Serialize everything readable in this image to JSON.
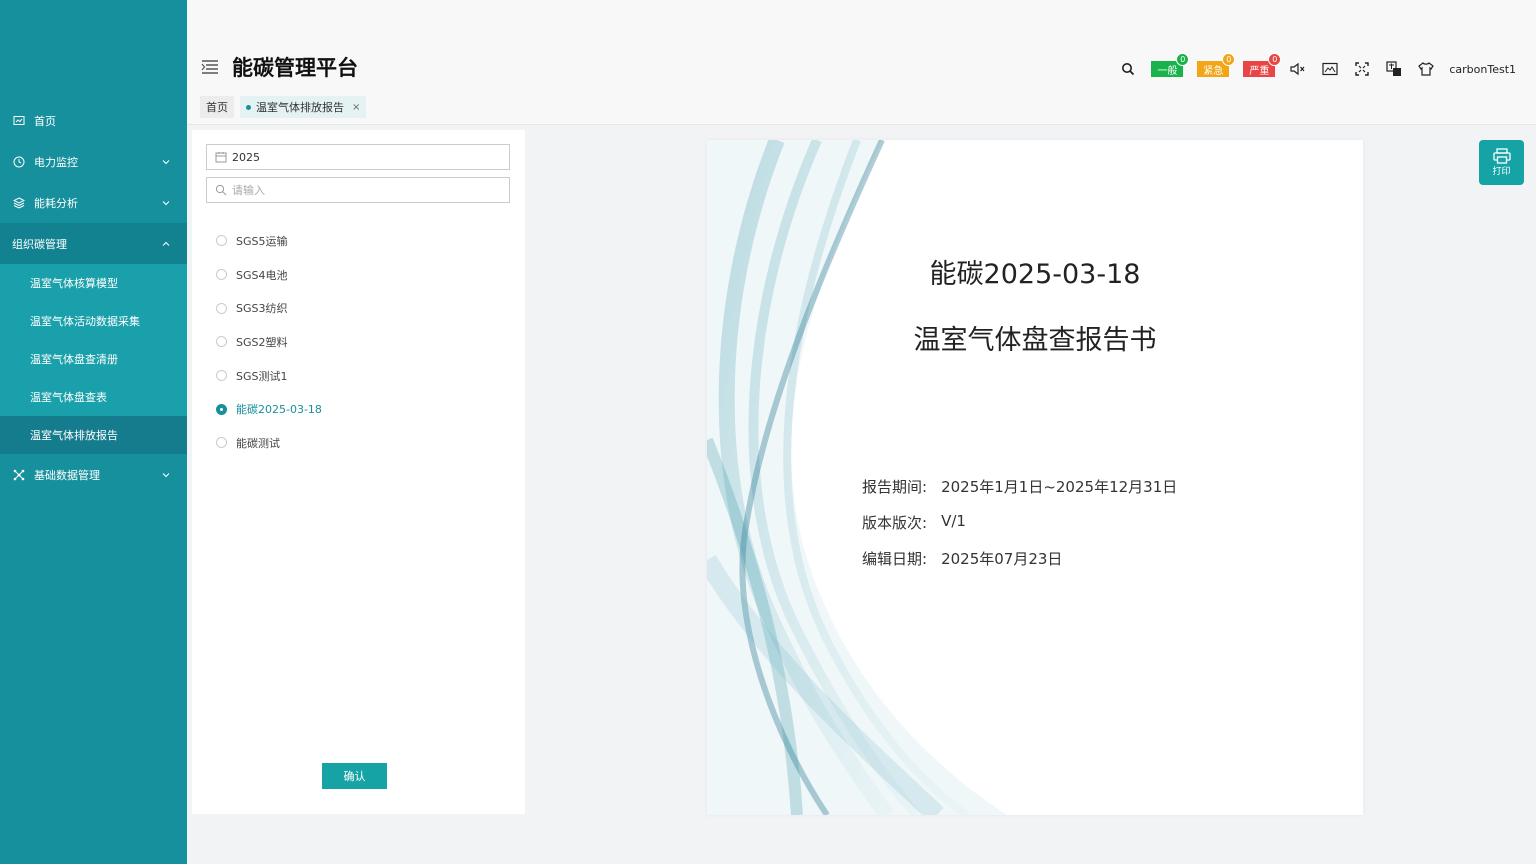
{
  "app": {
    "title": "能碳管理平台",
    "username": "carbonTest1"
  },
  "sidebar": {
    "items": [
      {
        "label": "首页",
        "icon": "home-icon"
      },
      {
        "label": "电力监控",
        "icon": "power-icon",
        "expandable": true
      },
      {
        "label": "能耗分析",
        "icon": "layers-icon",
        "expandable": true
      },
      {
        "label": "组织碳管理",
        "expandable": true,
        "open": true
      }
    ],
    "submenu": [
      {
        "label": "温室气体核算模型"
      },
      {
        "label": "温室气体活动数据采集"
      },
      {
        "label": "温室气体盘查清册"
      },
      {
        "label": "温室气体盘查表"
      },
      {
        "label": "温室气体排放报告",
        "active": true
      }
    ],
    "last": {
      "label": "基础数据管理",
      "icon": "network-icon"
    }
  },
  "tabs": [
    {
      "label": "首页"
    },
    {
      "label": "温室气体排放报告",
      "active": true
    }
  ],
  "alerts": [
    {
      "label": "一般",
      "count": "0",
      "color": "#19b24b"
    },
    {
      "label": "紧急",
      "count": "0",
      "color": "#f2a516"
    },
    {
      "label": "严重",
      "count": "0",
      "color": "#e84545"
    }
  ],
  "filter": {
    "year": "2025",
    "search_placeholder": "请输入"
  },
  "reports": [
    {
      "label": "SGS5运输",
      "checked": false
    },
    {
      "label": "SGS4电池",
      "checked": false
    },
    {
      "label": "SGS3纺织",
      "checked": false
    },
    {
      "label": "SGS2塑料",
      "checked": false
    },
    {
      "label": "SGS测试1",
      "checked": false
    },
    {
      "label": "能碳2025-03-18",
      "checked": true
    },
    {
      "label": "能碳测试",
      "checked": false
    }
  ],
  "confirm_label": "确认",
  "document": {
    "title1": "能碳2025-03-18",
    "title2": "温室气体盘查报告书",
    "meta": [
      {
        "k": "报告期间:",
        "v": "2025年1月1日~2025年12月31日"
      },
      {
        "k": "版本版次:",
        "v": "V/1"
      },
      {
        "k": "编辑日期:",
        "v": "2025年07月23日"
      }
    ]
  },
  "print_label": "打印",
  "colors": {
    "primary": "#16909c",
    "accent": "#16a3a6"
  }
}
